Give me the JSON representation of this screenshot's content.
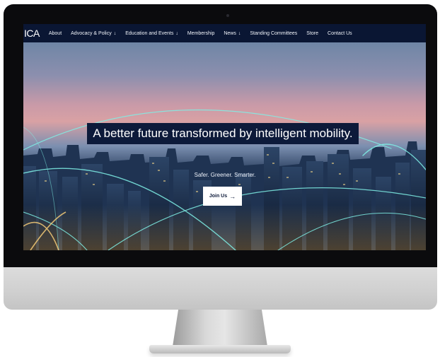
{
  "nav": {
    "logo": "ICA",
    "items": [
      {
        "label": "About",
        "has_dropdown": false
      },
      {
        "label": "Advocacy & Policy",
        "has_dropdown": true
      },
      {
        "label": "Education and Events",
        "has_dropdown": true
      },
      {
        "label": "Membership",
        "has_dropdown": false
      },
      {
        "label": "News",
        "has_dropdown": true
      },
      {
        "label": "Standing Committees",
        "has_dropdown": false
      },
      {
        "label": "Store",
        "has_dropdown": false
      },
      {
        "label": "Contact Us",
        "has_dropdown": false
      }
    ],
    "dropdown_glyph": "↓"
  },
  "hero": {
    "headline": "A better future transformed by intelligent mobility.",
    "tagline": "Safer. Greener. Smarter.",
    "cta_label": "Join Us",
    "cta_icon": "arrow-right-icon"
  },
  "colors": {
    "navbar_bg": "#0a1633",
    "headline_bg": "#0d1a3a",
    "light_trails": "#7ff0e6"
  }
}
